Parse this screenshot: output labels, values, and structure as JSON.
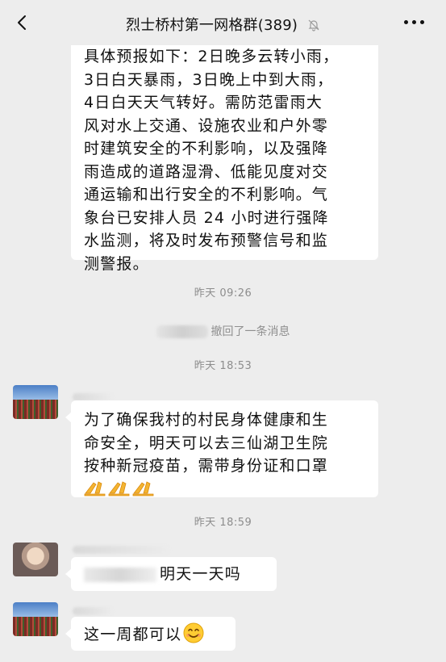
{
  "header": {
    "title": "烈士桥村第一网格群(389)",
    "back_icon": "chevron-left-icon",
    "mute_icon": "bell-off-icon",
    "more_icon": "more-dots-icon"
  },
  "messages": {
    "forecast": {
      "lines": [
        "具体预报如下：2日晚多云转小雨，",
        "3日白天暴雨，3日晚上中到大雨，",
        "4日白天天气转好。需防范雷雨大",
        "风对水上交通、设施农业和户外零",
        "时建筑安全的不利影响，以及强降",
        "雨造成的道路湿滑、低能见度对交",
        "通运输和出行安全的不利影响。气",
        "象台已安排人员 24 小时进行强降",
        "水监测，将及时发布预警信号和监",
        "测警报。"
      ]
    },
    "time_1": "昨天 09:26",
    "recall_text": "撤回了一条消息",
    "time_2": "昨天 18:53",
    "vaccine": {
      "lines": [
        "为了确保我村的村民身体健康和生",
        "命安全，明天可以去三仙湖卫生院",
        "按种新冠疫苗，需带身份证和口罩"
      ],
      "emoji": "clap-hands-icon"
    },
    "time_3": "昨天 18:59",
    "question": {
      "text": "明天一天吗"
    },
    "answer": {
      "text": "这一周都可以",
      "emoji": "smile-emoji-icon"
    }
  },
  "colors": {
    "background": "#ededed",
    "bubble": "#ffffff",
    "timestamp": "#8d8d8d"
  }
}
